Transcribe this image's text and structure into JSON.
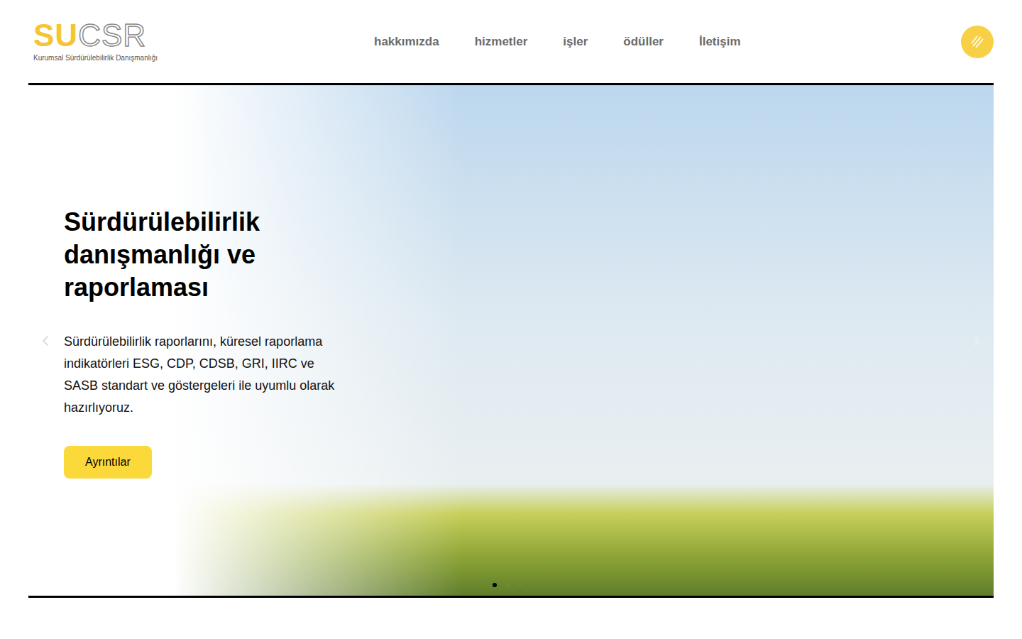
{
  "logo": {
    "accent": "SU",
    "main": "CSR",
    "subtitle": "Kurumsal Sürdürülebilirlik Danışmanlığı"
  },
  "nav": {
    "items": [
      {
        "label": "hakkımızda"
      },
      {
        "label": "hizmetler"
      },
      {
        "label": "işler"
      },
      {
        "label": "ödüller"
      },
      {
        "label": "İletişim"
      }
    ]
  },
  "hero": {
    "title": "Sürdürülebilirlik danışmanlığı ve raporlaması",
    "text": "Sürdürülebilirlik raporlarını, küresel raporlama indikatörleri ESG, CDP, CDSB, GRI, IIRC ve SASB standart ve göstergeleri ile uyumlu olarak hazırlıyoruz.",
    "button": "Ayrıntılar"
  },
  "slides": [
    {
      "selected": true
    },
    {
      "selected": false
    },
    {
      "selected": false
    }
  ]
}
